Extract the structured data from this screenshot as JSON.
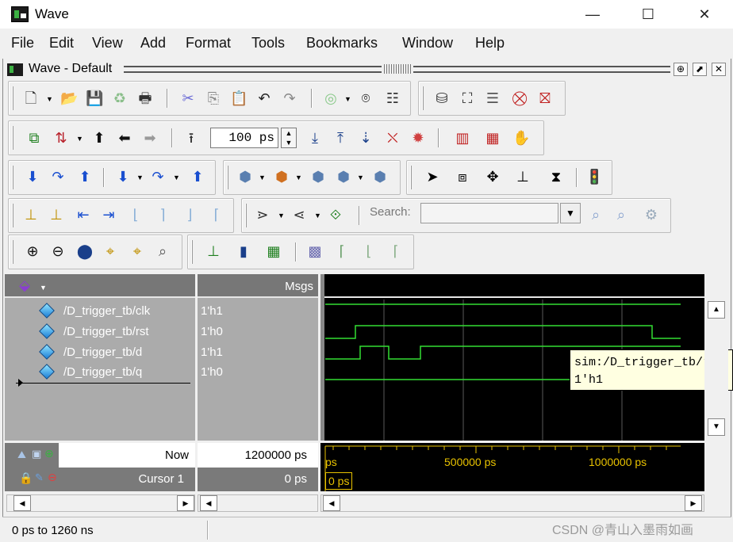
{
  "window": {
    "title": "Wave",
    "minimize_glyph": "—",
    "maximize_glyph": "☐",
    "close_glyph": "✕"
  },
  "menu": [
    "File",
    "Edit",
    "View",
    "Add",
    "Format",
    "Tools",
    "Bookmarks",
    "Window",
    "Help"
  ],
  "subwindow": {
    "title": "Wave - Default",
    "controls": [
      "⊕",
      "⬈",
      "✕"
    ]
  },
  "toolbar": {
    "zoom_value": "100 ps",
    "search_label": "Search:",
    "search_value": ""
  },
  "panes": {
    "values_header": "Msgs"
  },
  "signals": [
    {
      "name": "/D_trigger_tb/clk",
      "value": "1'h1"
    },
    {
      "name": "/D_trigger_tb/rst",
      "value": "1'h0"
    },
    {
      "name": "/D_trigger_tb/d",
      "value": "1'h1"
    },
    {
      "name": "/D_trigger_tb/q",
      "value": "1'h0"
    }
  ],
  "bottom": {
    "now_label": "Now",
    "now_value": "1200000 ps",
    "cursor_label": "Cursor 1",
    "cursor_value": "0 ps",
    "timeline_labels": [
      "ps",
      "500000 ps",
      "1000000 ps"
    ],
    "cursor_marker": "0 ps"
  },
  "tooltip": {
    "line1": "sim:/D_trigger_tb/r",
    "line2": "1'h1"
  },
  "status": {
    "range": "0 ps to 1260 ns"
  },
  "watermark": "CSDN @青山入墨雨如画",
  "colors": {
    "wave": "#33dd33",
    "grid": "#5a5a5a",
    "timeline_label": "#e8c200"
  }
}
